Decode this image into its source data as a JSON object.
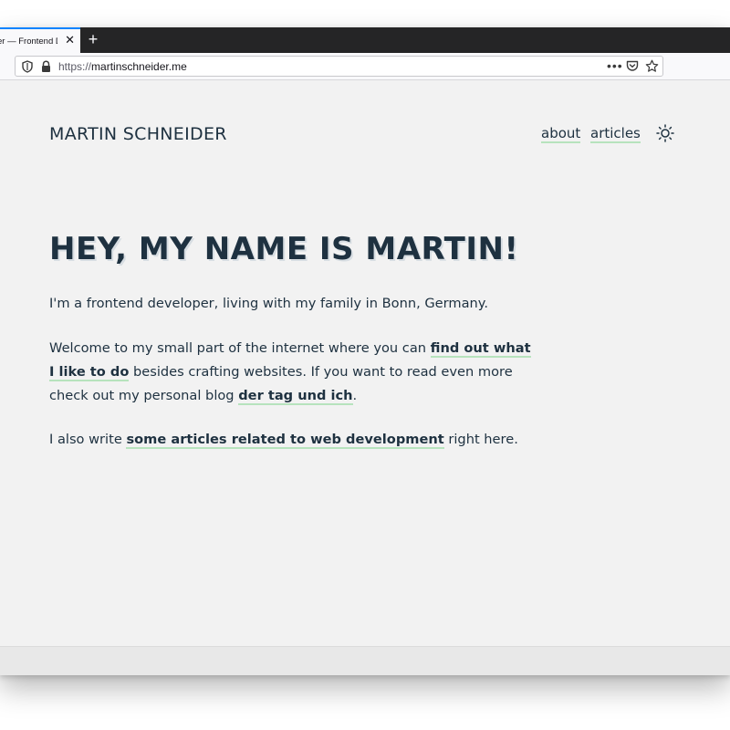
{
  "browser": {
    "tab_title": "er — Frontend D",
    "tab_close": "✕",
    "new_tab": "+",
    "url_scheme": "https://",
    "url_host": "martinschneider.me",
    "page_actions": "•••"
  },
  "header": {
    "site_title": "MARTIN SCHNEIDER",
    "nav": {
      "about": "about",
      "articles": "articles"
    },
    "theme_toggle_icon": "sun-icon"
  },
  "hero": {
    "title": "HEY, MY NAME IS MARTIN!",
    "intro": "I'm a frontend developer, living with my family in Bonn, Germany.",
    "p2_before": "Welcome to my small part of the internet where you can ",
    "p2_link1": "find out what I like to do",
    "p2_middle": " besides crafting websites. If you want to read even more check out my personal blog ",
    "p2_link2": "der tag und ich",
    "p2_after": ".",
    "p3_before": "I also write ",
    "p3_link": "some articles related to web development",
    "p3_after": " right here."
  },
  "colors": {
    "text": "#1e3140",
    "link_underline": "#b7e3bd",
    "page_bg": "#f2f2f2",
    "tab_accent": "#0a84ff"
  }
}
